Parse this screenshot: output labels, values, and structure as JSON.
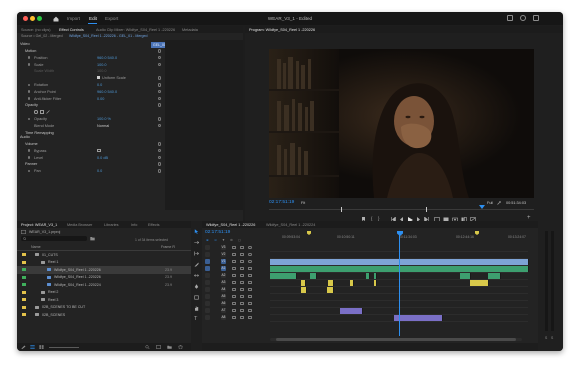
{
  "app": {
    "title": "WEAR_V3_1 - Edited",
    "workspace_tabs": [
      "Import",
      "Edit",
      "Export"
    ],
    "active_workspace": "Edit",
    "home_icon": "home-icon"
  },
  "source_panel": {
    "tabs": [
      "Source: (no clips)",
      "Effect Controls",
      "Audio Clip Mixer: Wildfye_S04_Reel 1 -220226",
      "Metadata"
    ],
    "active_tab": "Effect Controls",
    "breadcrumb_source": "Source • Gel_02 - Merged",
    "breadcrumb_sequence": "Wildfye_S04_Reel 1 -220226 - GEL_01 - Merged",
    "clip_label": "GEL_01 - Merged",
    "sections": {
      "video": "Video",
      "audio": "Audio"
    },
    "rows": [
      {
        "label": "Motion",
        "value": ""
      },
      {
        "label": "Position",
        "value": "960.0    540.0"
      },
      {
        "label": "Scale",
        "value": "100.0"
      },
      {
        "label": "Scale Width",
        "value": "100.0"
      },
      {
        "label": "",
        "value": "Uniform Scale"
      },
      {
        "label": "Rotation",
        "value": "0.0"
      },
      {
        "label": "Anchor Point",
        "value": "960.0    540.0"
      },
      {
        "label": "Anti-flicker Filter",
        "value": "0.00"
      },
      {
        "label": "Opacity",
        "value": ""
      },
      {
        "label": "Opacity",
        "value": "100.0 %"
      },
      {
        "label": "Blend Mode",
        "value": "Normal"
      },
      {
        "label": "Time Remapping",
        "value": ""
      },
      {
        "label": "Volume",
        "value": ""
      },
      {
        "label": "Bypass",
        "value": ""
      },
      {
        "label": "Level",
        "value": "0.0 dB"
      },
      {
        "label": "Panner",
        "value": ""
      },
      {
        "label": "Pan",
        "value": "0.0"
      }
    ],
    "footer_timecode": "02:17:31:19"
  },
  "program_monitor": {
    "tab": "Program: Wildfye_S04_Reel 1 -220226",
    "timecode": "02:17:51:19",
    "zoom": "Fit",
    "resolution": "Full",
    "duration": "00:51:34:03"
  },
  "project_panel": {
    "tabs": [
      "Project: WEAR_V3_1",
      "Media Browser",
      "Libraries",
      "Info",
      "Effects"
    ],
    "active_tab": "Project: WEAR_V3_1",
    "project_file": "WEAR_V3_1.prproj",
    "items_count": "1 of 34 items selected",
    "col_name": "Name",
    "col_frame": "Frame R",
    "rows": [
      {
        "name": "01_CUTS",
        "indent": 1,
        "color": "#e3c24a",
        "frame": "",
        "selected": false
      },
      {
        "name": "Reel 1",
        "indent": 2,
        "color": "#e3c24a",
        "frame": "",
        "selected": false
      },
      {
        "name": "Wildfye_S04_Reel 1 -220226",
        "indent": 3,
        "color": "#3fb05c",
        "frame": "23.9",
        "selected": true
      },
      {
        "name": "Wildfye_S04_Reel 1 -220226",
        "indent": 3,
        "color": "#3fb05c",
        "frame": "23.9",
        "selected": false
      },
      {
        "name": "Wildfye_S04_Reel 1 -220224",
        "indent": 3,
        "color": "#3fb05c",
        "frame": "23.9",
        "selected": false
      },
      {
        "name": "Reel 2",
        "indent": 2,
        "color": "#e3c24a",
        "frame": "",
        "selected": false
      },
      {
        "name": "Reel 3",
        "indent": 2,
        "color": "#e3c24a",
        "frame": "",
        "selected": false
      },
      {
        "name": "02B_SCENES TO BE CUT",
        "indent": 1,
        "color": "#e3c24a",
        "frame": "",
        "selected": false
      },
      {
        "name": "02B_SCENES",
        "indent": 1,
        "color": "#e3c24a",
        "frame": "",
        "selected": false
      }
    ]
  },
  "timeline": {
    "tabs": [
      "Wildfye_S04_Reel 1 -220226",
      "Wildfye_S04_Reel 1 -220224"
    ],
    "active_tab": "Wildfye_S04_Reel 1 -220226",
    "timecode": "02:17:51:19",
    "ruler": [
      "00:09:53:04",
      "00:10:50:11",
      "00:11:34:03",
      "00:12:44:16",
      "00:13:24:07"
    ],
    "video_tracks": [
      "V3",
      "V2",
      "V1"
    ],
    "audio_tracks": [
      "A1",
      "A2",
      "A3",
      "A4",
      "A5",
      "A6",
      "A7",
      "A8"
    ]
  },
  "colors": {
    "accent_blue": "#2d8ff0",
    "clip_video": "#7ea4d6",
    "clip_audio": "#3d9f6f",
    "clip_yellow": "#d8c84a",
    "clip_purple": "#7a6fc6"
  }
}
